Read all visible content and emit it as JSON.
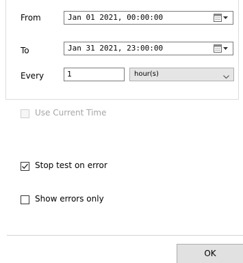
{
  "range": {
    "from": {
      "label": "From",
      "value": "Jan 01 2021, 00:00:00"
    },
    "to": {
      "label": "To",
      "value": "Jan 31 2021, 23:00:00"
    },
    "every": {
      "label": "Every",
      "value": "1",
      "unit": "hour(s)"
    }
  },
  "options": {
    "use_current_time": {
      "label": "Use Current Time",
      "checked": false,
      "enabled": false
    },
    "stop_on_error": {
      "label": "Stop test on error",
      "checked": true
    },
    "show_errors_only": {
      "label": "Show errors only",
      "checked": false
    }
  },
  "footer": {
    "ok_label": "OK"
  },
  "icons": {
    "calendar": "calendar-dropdown-icon",
    "chevron": "chevron-down-icon",
    "check": "checkmark-icon"
  }
}
